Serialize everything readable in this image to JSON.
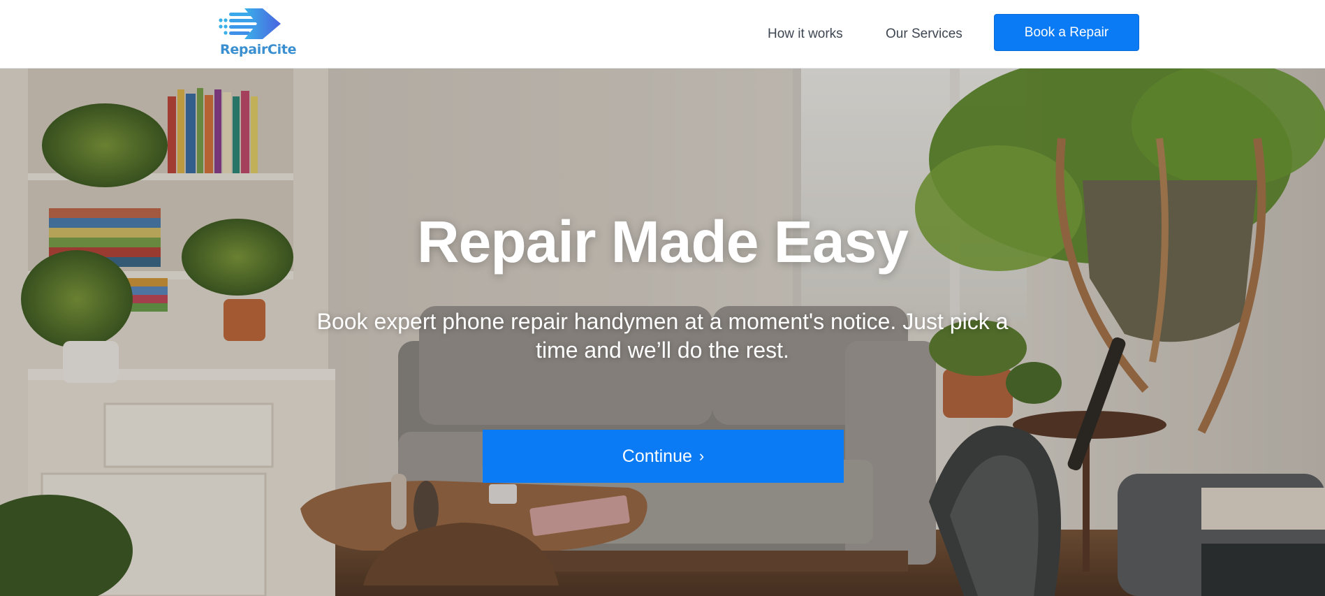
{
  "header": {
    "logo": {
      "text": "RepairCite",
      "icon": "arrow-logo-icon",
      "color": "#3a8fd0"
    },
    "nav": [
      {
        "label": "How it works"
      },
      {
        "label": "Our Services"
      }
    ],
    "cta_label": "Book a Repair"
  },
  "hero": {
    "title": "Repair Made Easy",
    "subtitle": "Book expert phone repair handymen at a moment's notice. Just pick a time and we’ll do the rest.",
    "continue_label": "Continue",
    "continue_icon": "chevron-right-icon",
    "background": "living-room-photo"
  },
  "colors": {
    "accent": "#0a7bf5",
    "nav_text": "#3e4651",
    "logo": "#3a8fd0"
  }
}
